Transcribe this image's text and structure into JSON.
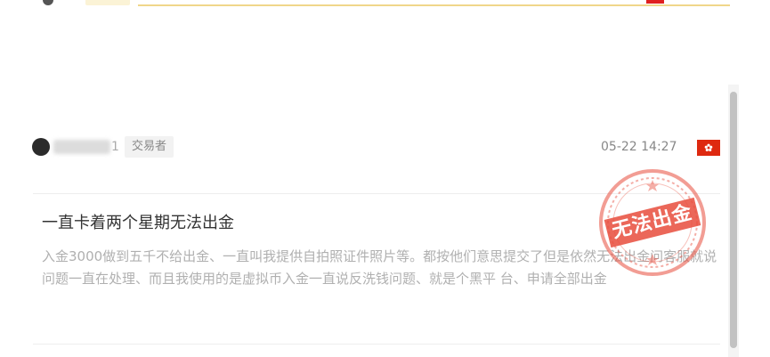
{
  "post": {
    "username": "1",
    "user_type": "交易者",
    "timestamp": "05-22 14:27",
    "region_flag": "hong-kong-flag",
    "title": "一直卡着两个星期无法出金",
    "body": "入金3000做到五千不给出金、一直叫我提供自拍照证件照片等。都按他们意思提交了但是依然无法出金问客服就说问题一直在处理、而且我使用的是虚拟币入金一直说反洗钱问题、就是个黑平 台、申请全部出金",
    "stamp_text": "无法出金"
  },
  "colors": {
    "stamp_red": "#e74c3c",
    "flag_red": "#de2910",
    "accent_yellow": "#f0d68a"
  }
}
